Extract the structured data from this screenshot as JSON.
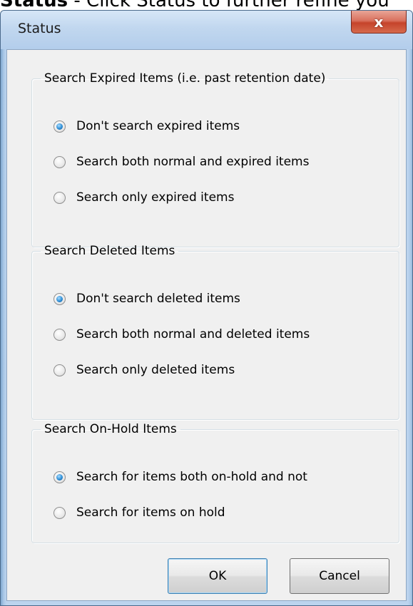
{
  "caption": {
    "bold_word": "Status",
    "rest": " - Click Status to further refine you"
  },
  "window": {
    "title": "Status",
    "close_glyph": "x",
    "accent_color": "#c5432b"
  },
  "groups": [
    {
      "legend": "Search Expired Items (i.e. past retention date)",
      "options": [
        {
          "label": "Don't search expired items",
          "selected": true
        },
        {
          "label": "Search both normal and expired items",
          "selected": false
        },
        {
          "label": "Search only expired items",
          "selected": false
        }
      ]
    },
    {
      "legend": "Search Deleted Items",
      "options": [
        {
          "label": "Don't search deleted items",
          "selected": true
        },
        {
          "label": "Search both normal and deleted items",
          "selected": false
        },
        {
          "label": "Search only deleted items",
          "selected": false
        }
      ]
    },
    {
      "legend": "Search On-Hold Items",
      "options": [
        {
          "label": "Search for items both on-hold and not",
          "selected": true
        },
        {
          "label": "Search for items on hold",
          "selected": false
        }
      ]
    }
  ],
  "buttons": {
    "ok": "OK",
    "cancel": "Cancel"
  }
}
